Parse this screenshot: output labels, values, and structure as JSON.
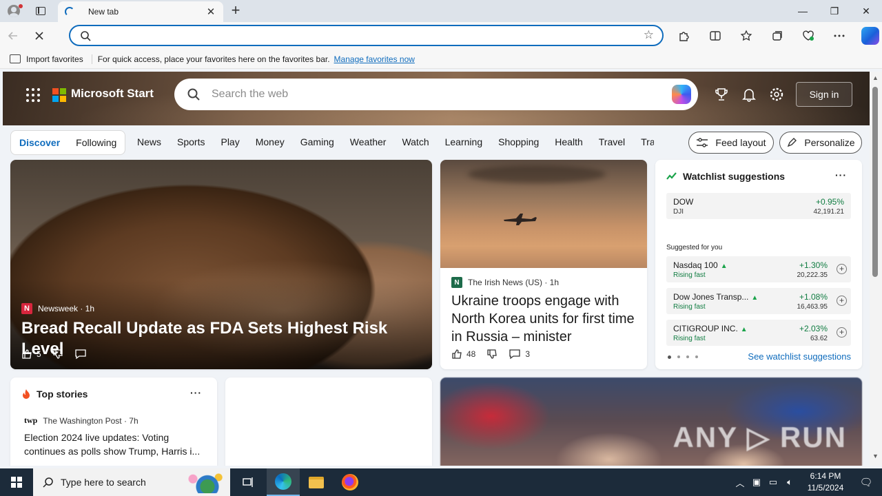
{
  "browser": {
    "tab_title": "New tab",
    "tab_close": "✕",
    "new_tab": "+",
    "window_controls": [
      "—",
      "❐",
      "✕"
    ],
    "favorites_bar": {
      "import_label": "Import favorites",
      "message": "For quick access, place your favorites here on the favorites bar.",
      "manage_link": "Manage favorites now"
    }
  },
  "header": {
    "brand": "Microsoft Start",
    "search_placeholder": "Search the web",
    "sign_in": "Sign in"
  },
  "nav": {
    "pills": [
      "Discover",
      "Following"
    ],
    "categories": [
      "News",
      "Sports",
      "Play",
      "Money",
      "Gaming",
      "Weather",
      "Watch",
      "Learning",
      "Shopping",
      "Health",
      "Travel",
      "Traf"
    ],
    "feed_layout": "Feed layout",
    "personalize": "Personalize"
  },
  "hero": {
    "source_logo": "N",
    "source": "Newsweek · 1h",
    "headline": "Bread Recall Update as FDA Sets Highest Risk Level",
    "likes": "5"
  },
  "jet_story": {
    "source_logo": "N",
    "source": "The Irish News (US) · 1h",
    "headline": "Ukraine troops engage with North Korea units for first time in Russia – minister",
    "likes": "48",
    "comments": "3"
  },
  "watchlist": {
    "title": "Watchlist suggestions",
    "more": "···",
    "main": {
      "name": "DOW",
      "symbol": "DJI",
      "change": "+0.95%",
      "value": "42,191.21"
    },
    "suggested_label": "Suggested for you",
    "suggested": [
      {
        "name": "Nasdaq 100",
        "status": "Rising fast",
        "change": "+1.30%",
        "value": "20,222.35"
      },
      {
        "name": "Dow Jones Transp...",
        "status": "Rising fast",
        "change": "+1.08%",
        "value": "16,463.95"
      },
      {
        "name": "CITIGROUP INC.",
        "status": "Rising fast",
        "change": "+2.03%",
        "value": "63.62"
      }
    ],
    "link": "See watchlist suggestions"
  },
  "top_stories": {
    "title": "Top stories",
    "more": "···",
    "source_logo": "twp",
    "source": "The Washington Post · 7h",
    "headline": "Election 2024 live updates: Voting continues as polls show Trump, Harris i..."
  },
  "watermark": "ANY ▷ RUN",
  "taskbar": {
    "search_placeholder": "Type here to search",
    "time": "6:14 PM",
    "date": "11/5/2024"
  },
  "colors": {
    "accent": "#0f6cbd",
    "positive": "#107c41",
    "taskbar": "#1c2b3a"
  }
}
